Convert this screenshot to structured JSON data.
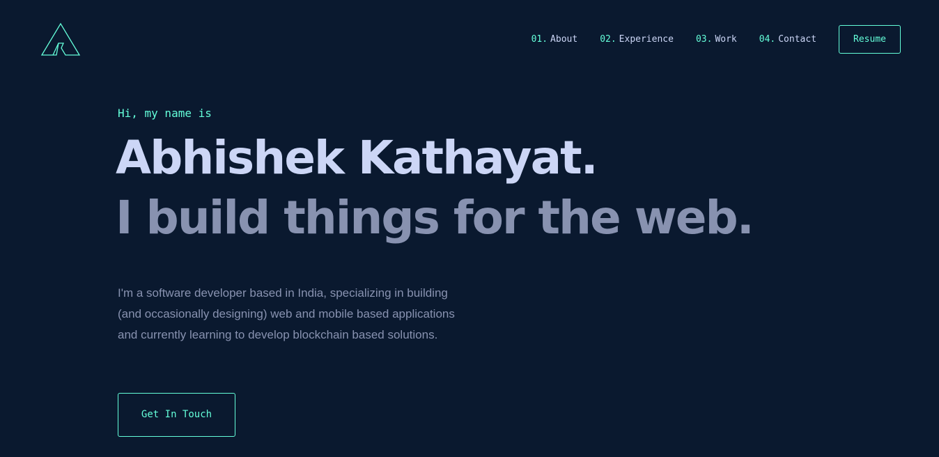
{
  "colors": {
    "background": "#0a192f",
    "accent": "#64ffda",
    "heading": "#ccd6f6",
    "muted": "#8892b0"
  },
  "header": {
    "logo_icon": "a-monogram-logo-icon",
    "nav": [
      {
        "num": "01.",
        "label": "About"
      },
      {
        "num": "02.",
        "label": "Experience"
      },
      {
        "num": "03.",
        "label": "Work"
      },
      {
        "num": "04.",
        "label": "Contact"
      }
    ],
    "resume_label": "Resume"
  },
  "hero": {
    "greeting": "Hi, my name is",
    "name": "Abhishek Kathayat.",
    "tagline": "I build things for the web.",
    "bio_lines": [
      "I'm a software developer based in India, specializing in building",
      "(and occasionally designing) web and mobile based applications",
      "and currently learning to develop blockchain based solutions."
    ],
    "cta_label": "Get In Touch"
  }
}
